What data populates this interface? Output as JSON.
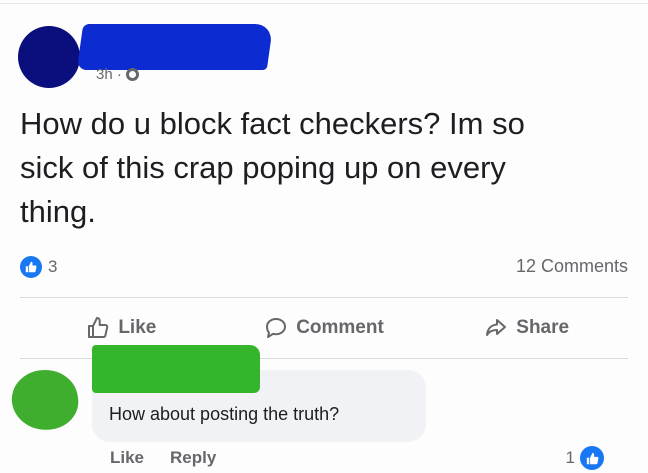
{
  "post": {
    "timestamp": "3h ·",
    "privacy_icon": "globe-icon",
    "text": "How do u block fact checkers? Im so\nsick of this crap poping up on every\nthing.",
    "reaction_count": "3",
    "comments_count": "12 Comments"
  },
  "actions": {
    "like_label": "Like",
    "comment_label": "Comment",
    "share_label": "Share"
  },
  "comment": {
    "text": "How about posting the truth?",
    "like_label": "Like",
    "reply_label": "Reply",
    "reaction_count": "1"
  },
  "colors": {
    "facebook_blue": "#1877f2",
    "muted_text": "#65676b",
    "bubble_bg": "#f0f2f5",
    "redaction_blue": "#0c2bd0",
    "redaction_green": "#34b52c"
  }
}
